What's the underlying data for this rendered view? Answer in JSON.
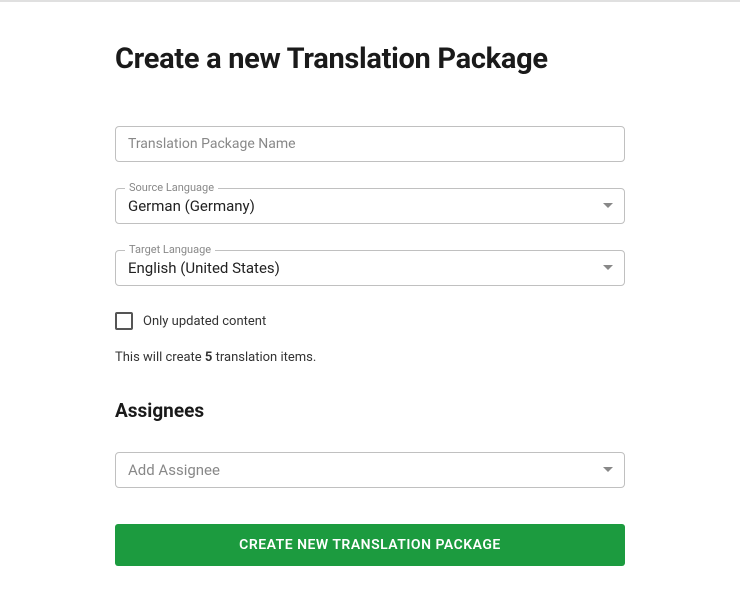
{
  "page": {
    "title": "Create a new Translation Package"
  },
  "form": {
    "name": {
      "placeholder": "Translation Package Name",
      "value": ""
    },
    "sourceLanguage": {
      "label": "Source Language",
      "value": "German (Germany)"
    },
    "targetLanguage": {
      "label": "Target Language",
      "value": "English (United States)"
    },
    "onlyUpdated": {
      "label": "Only updated content",
      "checked": false
    },
    "info": {
      "prefix": "This will create ",
      "count": "5",
      "suffix": " translation items."
    }
  },
  "assignees": {
    "heading": "Assignees",
    "placeholder": "Add Assignee"
  },
  "submit": {
    "label": "CREATE NEW TRANSLATION PACKAGE"
  }
}
